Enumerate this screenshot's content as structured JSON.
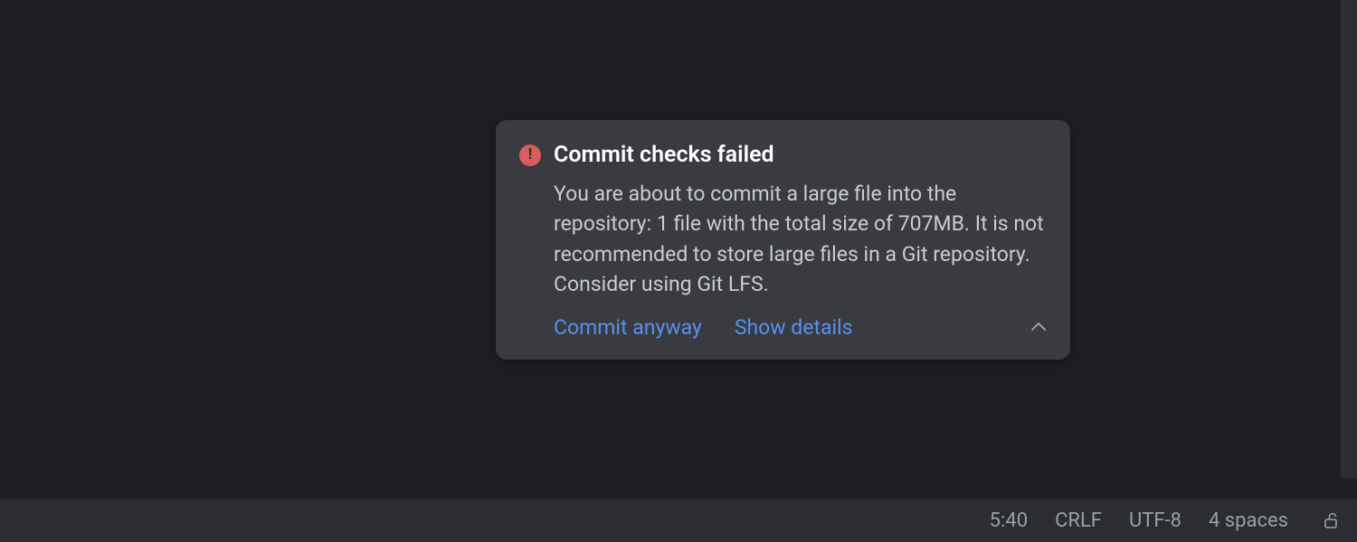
{
  "notification": {
    "title": "Commit checks failed",
    "body": "You are about to commit a large file into the repository: 1 file with the total size of 707MB. It is not recommended to store large files in a Git repository. Consider using Git LFS.",
    "actions": {
      "commit_anyway": "Commit anyway",
      "show_details": "Show details"
    }
  },
  "status_bar": {
    "cursor_position": "5:40",
    "line_ending": "CRLF",
    "encoding": "UTF-8",
    "indent": "4 spaces"
  }
}
